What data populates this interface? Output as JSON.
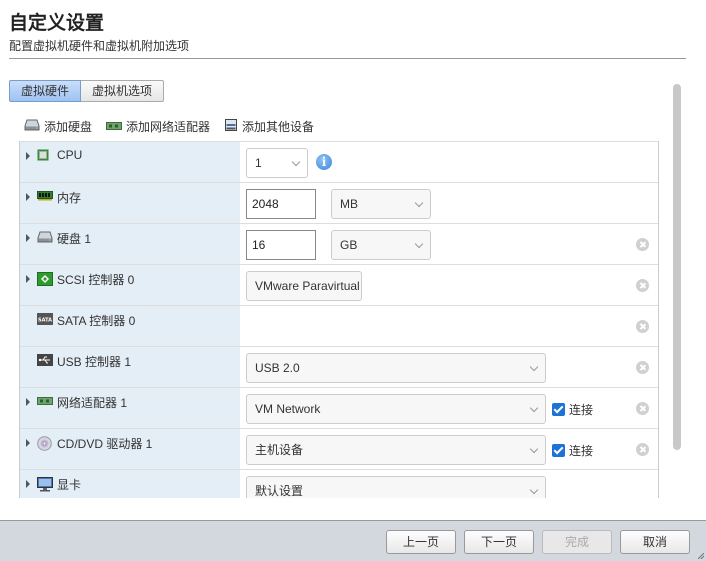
{
  "header": {
    "title": "自定义设置",
    "subtitle": "配置虚拟机硬件和虚拟机附加选项"
  },
  "tabs": [
    {
      "label": "虚拟硬件",
      "active": true
    },
    {
      "label": "虚拟机选项",
      "active": false
    }
  ],
  "toolbar": {
    "add_disk": "添加硬盘",
    "add_network": "添加网络适配器",
    "add_other": "添加其他设备"
  },
  "hardware": {
    "cpu": {
      "label": "CPU",
      "value": "1",
      "icon": "cpu-icon"
    },
    "memory": {
      "label": "内存",
      "value": "2048",
      "unit": "MB",
      "icon": "memory-icon"
    },
    "disk": {
      "label": "硬盘 1",
      "value": "16",
      "unit": "GB",
      "icon": "hard-disk-icon"
    },
    "scsi": {
      "label": "SCSI 控制器 0",
      "value": "VMware Paravirtual",
      "icon": "scsi-controller-icon"
    },
    "sata": {
      "label": "SATA 控制器 0",
      "icon": "sata-controller-icon",
      "icon_text": "SATA"
    },
    "usb": {
      "label": "USB 控制器 1",
      "value": "USB 2.0",
      "icon": "usb-icon"
    },
    "network": {
      "label": "网络适配器 1",
      "value": "VM Network",
      "connect_label": "连接",
      "connected": true,
      "icon": "network-adapter-icon"
    },
    "cdrom": {
      "label": "CD/DVD 驱动器 1",
      "value": "主机设备",
      "connect_label": "连接",
      "connected": true,
      "icon": "cd-dvd-icon"
    },
    "video": {
      "label": "显卡",
      "value": "默认设置",
      "icon": "monitor-icon"
    }
  },
  "footer": {
    "back": "上一页",
    "next": "下一页",
    "finish": "完成",
    "cancel": "取消"
  },
  "colors": {
    "accent": "#1e72d6",
    "label_bg": "#e4eef6",
    "footer_bg": "#d3d8df"
  }
}
